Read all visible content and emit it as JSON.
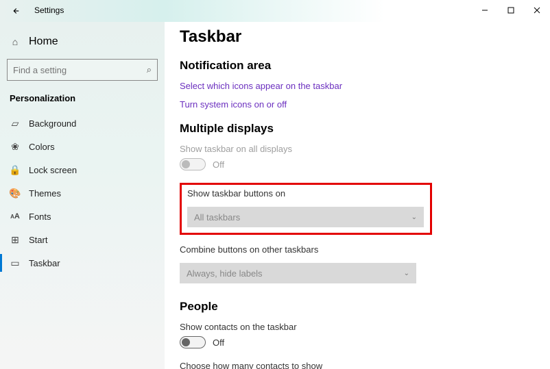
{
  "app": {
    "title": "Settings"
  },
  "search": {
    "placeholder": "Find a setting"
  },
  "home": {
    "label": "Home"
  },
  "section": "Personalization",
  "nav": [
    {
      "label": "Background",
      "icon": "▱"
    },
    {
      "label": "Colors",
      "icon": "❀"
    },
    {
      "label": "Lock screen",
      "icon": "🔒"
    },
    {
      "label": "Themes",
      "icon": "🎨"
    },
    {
      "label": "Fonts",
      "icon": "A"
    },
    {
      "label": "Start",
      "icon": "⊞"
    },
    {
      "label": "Taskbar",
      "icon": "▭"
    }
  ],
  "page": {
    "title": "Taskbar",
    "notif": {
      "heading": "Notification area",
      "link1": "Select which icons appear on the taskbar",
      "link2": "Turn system icons on or off"
    },
    "multi": {
      "heading": "Multiple displays",
      "showAll": {
        "label": "Show taskbar on all displays",
        "state": "Off"
      },
      "buttonsOn": {
        "label": "Show taskbar buttons on",
        "value": "All taskbars"
      },
      "combine": {
        "label": "Combine buttons on other taskbars",
        "value": "Always, hide labels"
      }
    },
    "people": {
      "heading": "People",
      "contacts": {
        "label": "Show contacts on the taskbar",
        "state": "Off"
      },
      "choose": "Choose how many contacts to show"
    }
  }
}
